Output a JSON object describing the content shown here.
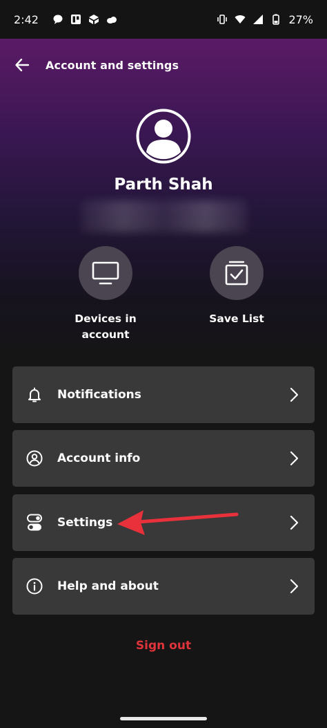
{
  "status_bar": {
    "time": "2:42",
    "battery": "27%"
  },
  "header": {
    "title": "Account and settings"
  },
  "profile": {
    "name": "Parth Shah"
  },
  "quick_actions": [
    {
      "label_line1": "Devices in",
      "label_line2": "account"
    },
    {
      "label_line1": "Save List",
      "label_line2": ""
    }
  ],
  "menu": [
    {
      "label": "Notifications",
      "icon": "bell-icon"
    },
    {
      "label": "Account info",
      "icon": "user-circle-icon"
    },
    {
      "label": "Settings",
      "icon": "toggles-icon"
    },
    {
      "label": "Help and about",
      "icon": "info-icon"
    }
  ],
  "sign_out": "Sign out",
  "colors": {
    "accent_red": "#e0343c",
    "card_bg": "#393939",
    "hero_purple": "#5a1a66",
    "annotation_arrow": "#e8313b"
  }
}
